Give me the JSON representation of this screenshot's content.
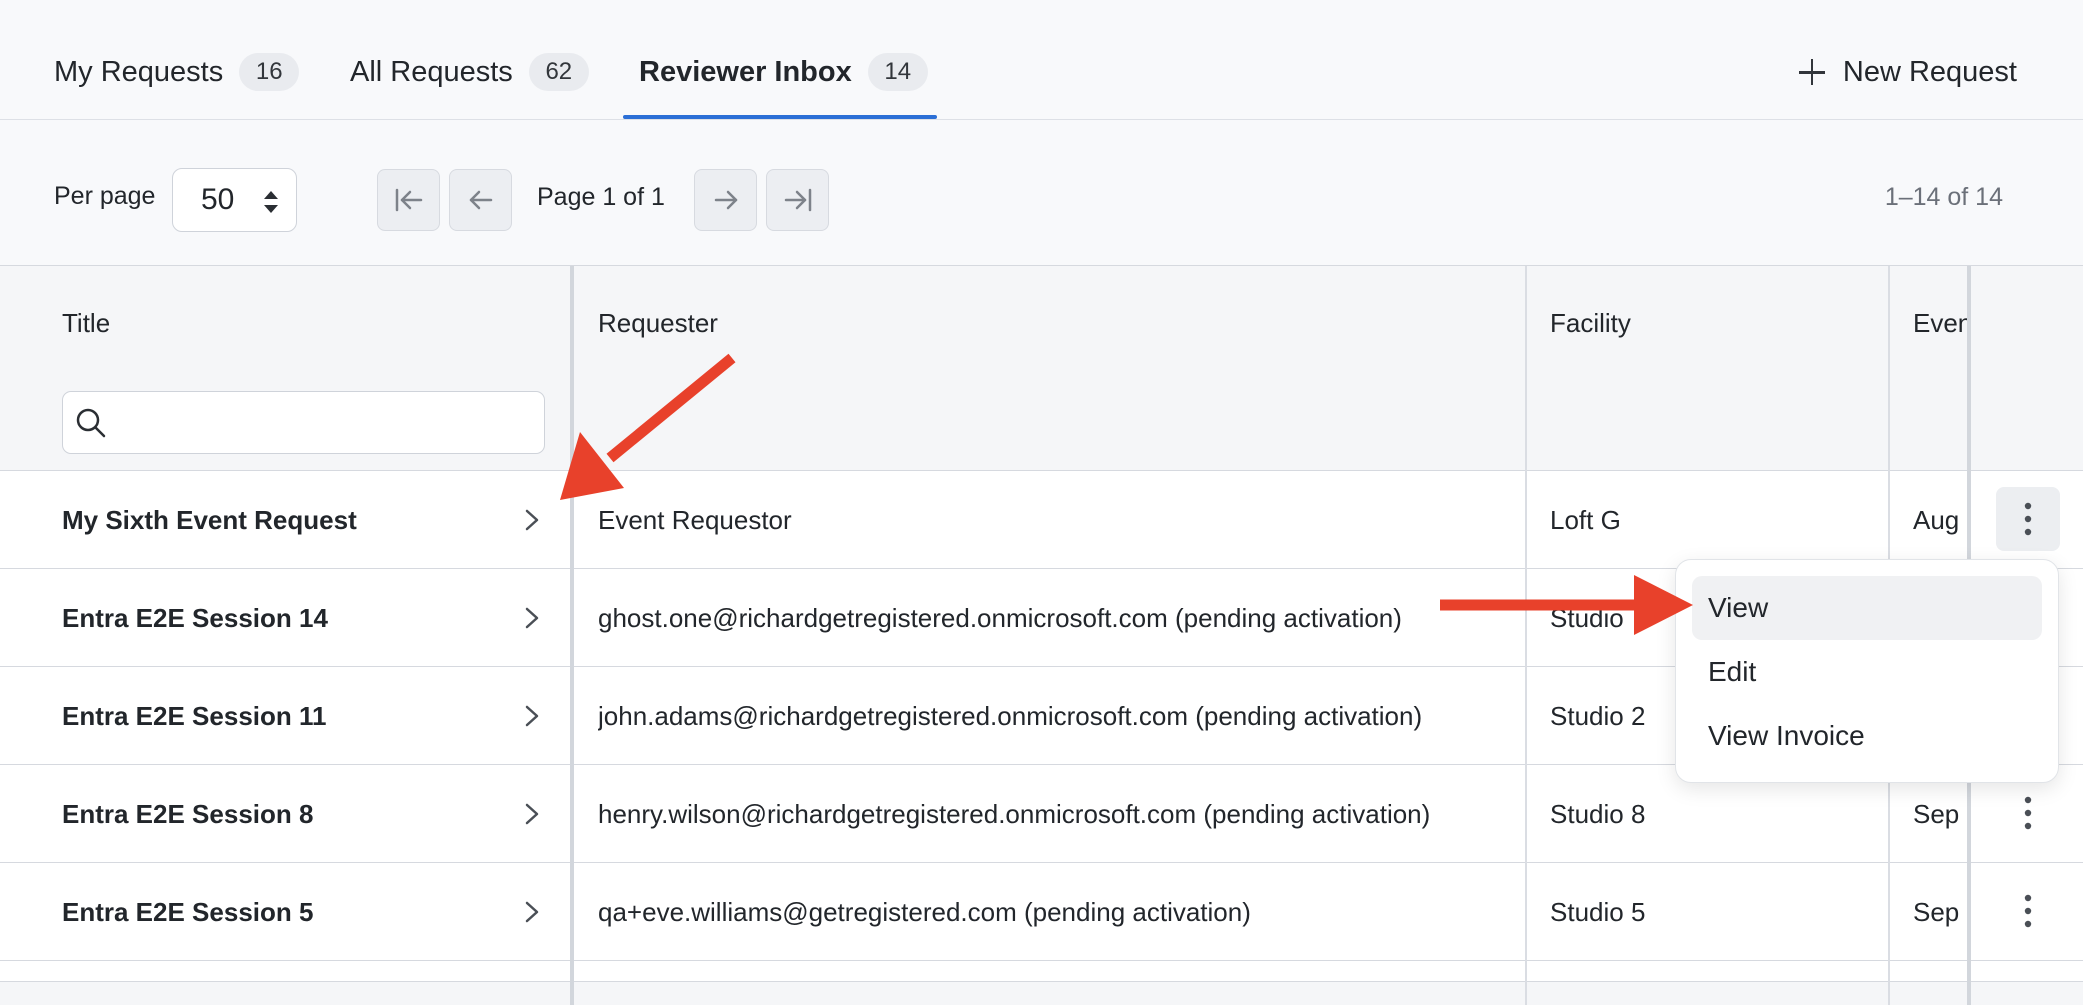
{
  "tabs": [
    {
      "label": "My Requests",
      "count": "16"
    },
    {
      "label": "All Requests",
      "count": "62"
    },
    {
      "label": "Reviewer Inbox",
      "count": "14"
    }
  ],
  "header": {
    "new_request_label": "New Request"
  },
  "pagination": {
    "per_page_label": "Per page",
    "per_page_value": "50",
    "page_label": "Page 1 of 1",
    "range_label": "1–14 of 14"
  },
  "table": {
    "columns": [
      "Title",
      "Requester",
      "Facility",
      "Even"
    ],
    "filter_placeholder": "",
    "rows": [
      {
        "title": "My Sixth Event Request",
        "requester": "Event Requestor",
        "facility": "Loft G",
        "event": "Aug"
      },
      {
        "title": "Entra E2E Session 14",
        "requester": "ghost.one@richardgetregistered.onmicrosoft.com (pending activation)",
        "facility": "Studio",
        "event": ""
      },
      {
        "title": "Entra E2E Session 11",
        "requester": "john.adams@richardgetregistered.onmicrosoft.com (pending activation)",
        "facility": "Studio 2",
        "event": ""
      },
      {
        "title": "Entra E2E Session 8",
        "requester": "henry.wilson@richardgetregistered.onmicrosoft.com (pending activation)",
        "facility": "Studio 8",
        "event": "Sep"
      },
      {
        "title": "Entra E2E Session 5",
        "requester": "qa+eve.williams@getregistered.com (pending activation)",
        "facility": "Studio 5",
        "event": "Sep"
      }
    ]
  },
  "row_menu": {
    "items": [
      "View",
      "Edit",
      "View Invoice"
    ]
  },
  "colors": {
    "accent": "#2b6fd6",
    "annotation_arrow": "#e8412b"
  },
  "icons": {
    "first_page": "first-page-icon",
    "prev_page": "arrow-left-icon",
    "next_page": "arrow-right-icon",
    "last_page": "last-page-icon",
    "search": "search-icon",
    "row_open": "chevron-right-icon",
    "row_menu": "kebab-menu-icon",
    "add": "plus-icon"
  }
}
